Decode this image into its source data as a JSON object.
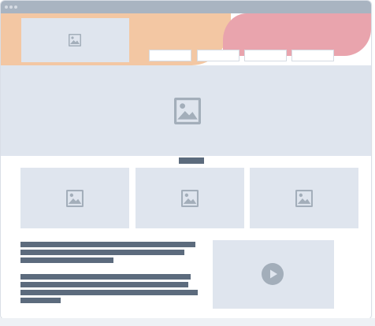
{
  "window": {
    "controls": [
      "window-dot-icon",
      "window-dot-icon",
      "window-dot-icon"
    ]
  },
  "colors": {
    "titlebar": "#a9b4c1",
    "hero_peach": "#f3c7a3",
    "hero_pink": "#e9a4ad",
    "placeholder": "#dfe5ee",
    "placeholder_icon": "#a3aeba",
    "text_bar": "#5c6b7d"
  },
  "header": {
    "logo_icon": "image-placeholder-icon",
    "nav_items": [
      "",
      "",
      "",
      ""
    ]
  },
  "banner": {
    "icon": "image-placeholder-icon"
  },
  "cards": [
    {
      "icon": "image-placeholder-icon"
    },
    {
      "icon": "image-placeholder-icon"
    },
    {
      "icon": "image-placeholder-icon"
    }
  ],
  "content": {
    "text_lines": 6,
    "video_icon": "play-icon"
  }
}
